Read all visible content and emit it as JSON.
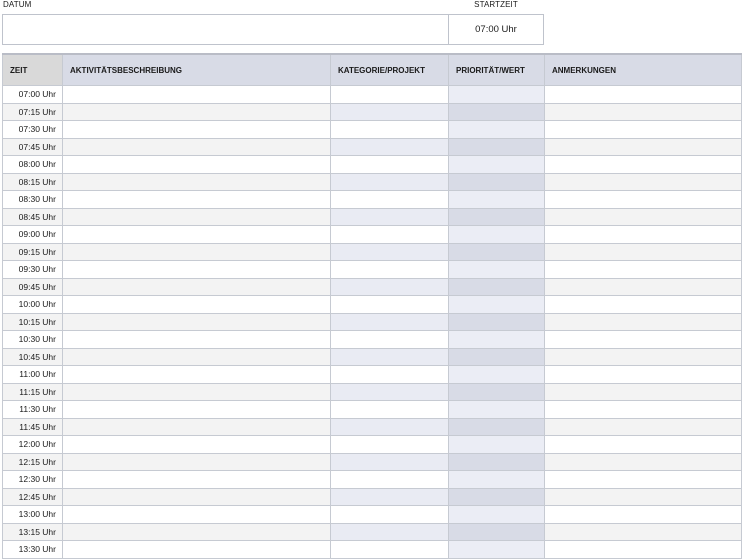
{
  "header": {
    "datum_label": "DATUM",
    "datum_value": "",
    "startzeit_label": "STARTZEIT",
    "startzeit_value": "07:00 Uhr"
  },
  "table": {
    "columns": [
      "ZEIT",
      "AKTIVITÄTSBESCHREIBUNG",
      "KATEGORIE/PROJEKT",
      "PRIORITÄT/WERT",
      "ANMERKUNGEN"
    ],
    "times": [
      "07:00 Uhr",
      "07:15 Uhr",
      "07:30 Uhr",
      "07:45 Uhr",
      "08:00 Uhr",
      "08:15 Uhr",
      "08:30 Uhr",
      "08:45 Uhr",
      "09:00 Uhr",
      "09:15 Uhr",
      "09:30 Uhr",
      "09:45 Uhr",
      "10:00 Uhr",
      "10:15 Uhr",
      "10:30 Uhr",
      "10:45 Uhr",
      "11:00 Uhr",
      "11:15 Uhr",
      "11:30 Uhr",
      "11:45 Uhr",
      "12:00 Uhr",
      "12:15 Uhr",
      "12:30 Uhr",
      "12:45 Uhr",
      "13:00 Uhr",
      "13:15 Uhr",
      "13:30 Uhr"
    ]
  }
}
